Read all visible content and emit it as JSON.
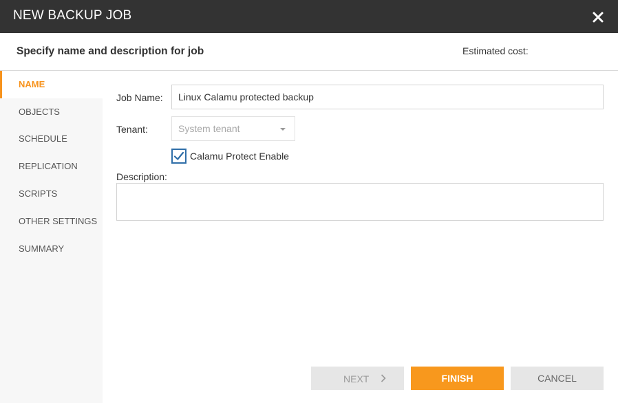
{
  "dialog": {
    "title": "NEW BACKUP JOB",
    "close_icon": "close-icon"
  },
  "header": {
    "step_title": "Specify name and description for job",
    "estimated_cost_label": "Estimated cost:"
  },
  "sidebar": {
    "items": [
      {
        "label": "NAME",
        "active": true
      },
      {
        "label": "OBJECTS",
        "active": false
      },
      {
        "label": "SCHEDULE",
        "active": false
      },
      {
        "label": "REPLICATION",
        "active": false
      },
      {
        "label": "SCRIPTS",
        "active": false
      },
      {
        "label": "OTHER SETTINGS",
        "active": false
      },
      {
        "label": "SUMMARY",
        "active": false
      }
    ]
  },
  "form": {
    "job_name_label": "Job Name:",
    "job_name_value": "Linux Calamu protected backup",
    "tenant_label": "Tenant:",
    "tenant_value": "System tenant",
    "calamu_label": "Calamu Protect Enable",
    "calamu_checked": true,
    "description_label": "Description:",
    "description_value": ""
  },
  "footer": {
    "next_label": "NEXT",
    "finish_label": "FINISH",
    "cancel_label": "CANCEL"
  },
  "colors": {
    "titlebar": "#333333",
    "accent": "#f8981d",
    "checkbox": "#2f6ea8"
  }
}
